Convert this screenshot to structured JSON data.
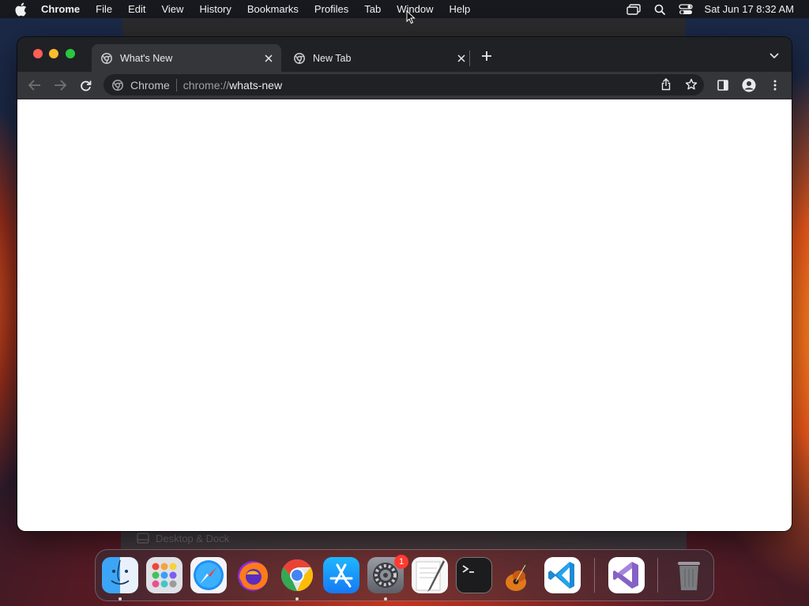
{
  "menubar": {
    "app_name": "Chrome",
    "items": [
      "File",
      "Edit",
      "View",
      "History",
      "Bookmarks",
      "Profiles",
      "Tab",
      "Window",
      "Help"
    ],
    "clock": "Sat Jun 17  8:32 AM",
    "status_icons": [
      "screen-mirroring-icon",
      "spotlight-search-icon",
      "control-center-icon"
    ]
  },
  "browser": {
    "tabs": [
      {
        "title": "What's New",
        "active": true
      },
      {
        "title": "New Tab",
        "active": false
      }
    ],
    "omnibox": {
      "chip": "Chrome",
      "url_scheme": "chrome://",
      "url_host": "whats-new"
    }
  },
  "background_window": {
    "label": "Desktop & Dock"
  },
  "dock": {
    "apps": [
      "Finder",
      "Launchpad",
      "Safari",
      "Firefox",
      "Google Chrome",
      "App Store",
      "System Settings",
      "TextEdit",
      "Terminal",
      "GarageBand",
      "Visual Studio Code",
      "Visual Studio",
      "Trash"
    ],
    "system_settings_badge": "1"
  },
  "colors": {
    "accent_red": "#ff5f57",
    "accent_yellow": "#febc2e",
    "accent_green": "#28c840",
    "chrome_dark": "#202124",
    "toolbar": "#35363a"
  }
}
